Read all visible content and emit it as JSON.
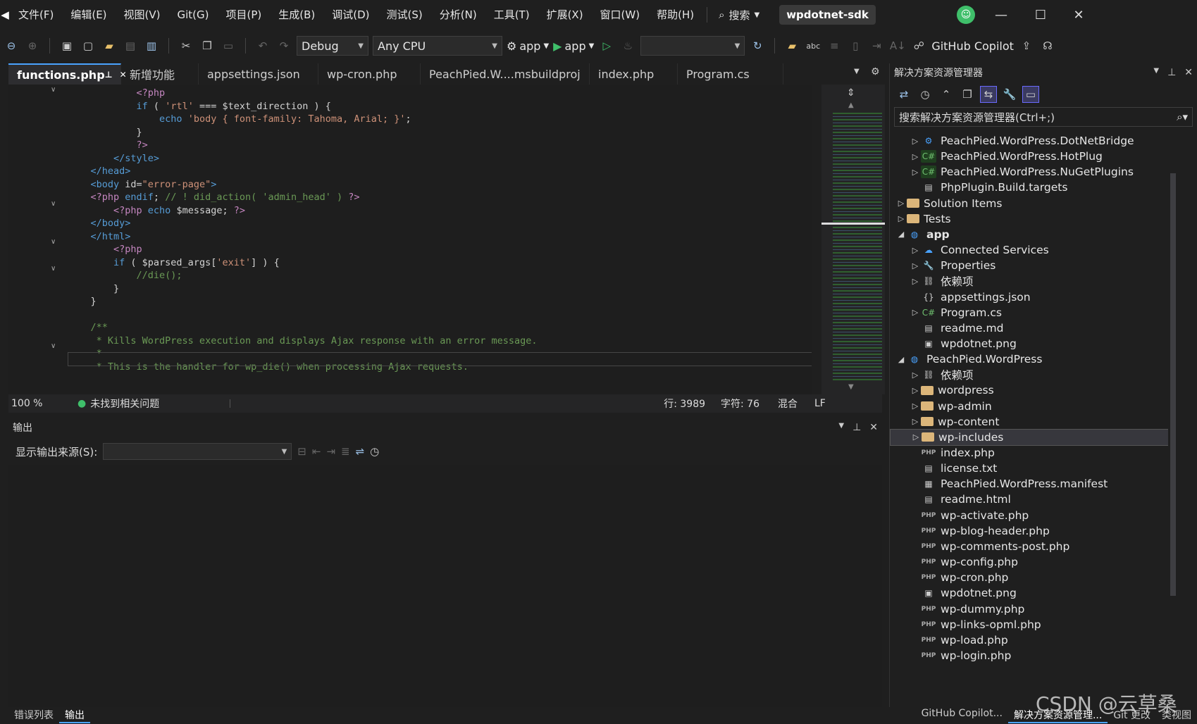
{
  "menubar": {
    "items": [
      "文件(F)",
      "编辑(E)",
      "视图(V)",
      "Git(G)",
      "项目(P)",
      "生成(B)",
      "调试(D)",
      "测试(S)",
      "分析(N)",
      "工具(T)",
      "扩展(X)",
      "窗口(W)",
      "帮助(H)"
    ],
    "search_label": "搜索",
    "solution_title": "wpdotnet-sdk"
  },
  "toolbar": {
    "config": "Debug",
    "platform": "Any CPU",
    "startup1": "app",
    "startup2": "app",
    "copilot": "GitHub Copilot"
  },
  "tabs": [
    "functions.php",
    "新增功能",
    "appsettings.json",
    "wp-cron.php",
    "PeachPied.W....msbuildproj",
    "index.php",
    "Program.cs"
  ],
  "editor": {
    "lines": [
      [
        {
          "c": "ph",
          "t": "            <?php"
        }
      ],
      [
        {
          "c": "kw",
          "t": "            if"
        },
        {
          "c": "tx",
          "t": " ( "
        },
        {
          "c": "st",
          "t": "'rtl'"
        },
        {
          "c": "tx",
          "t": " === $text_direction ) {"
        }
      ],
      [
        {
          "c": "kw",
          "t": "                echo "
        },
        {
          "c": "st",
          "t": "'body { font-family: Tahoma, Arial; }'"
        },
        {
          "c": "tx",
          "t": ";"
        }
      ],
      [
        {
          "c": "tx",
          "t": "            }"
        }
      ],
      [
        {
          "c": "ph",
          "t": "            ?>"
        }
      ],
      [
        {
          "c": "kw",
          "t": "        </style>"
        }
      ],
      [
        {
          "c": "kw",
          "t": "    </head>"
        }
      ],
      [
        {
          "c": "kw",
          "t": "    <body "
        },
        {
          "c": "tx",
          "t": "id="
        },
        {
          "c": "st",
          "t": "\"error-page\""
        },
        {
          "c": "kw",
          "t": ">"
        }
      ],
      [
        {
          "c": "ph",
          "t": "    <?php "
        },
        {
          "c": "kw",
          "t": "endif"
        },
        {
          "c": "tx",
          "t": "; "
        },
        {
          "c": "cm",
          "t": "// ! did_action( 'admin_head' ) "
        },
        {
          "c": "ph",
          "t": "?>"
        }
      ],
      [
        {
          "c": "ph",
          "t": "        <?php "
        },
        {
          "c": "kw",
          "t": "echo "
        },
        {
          "c": "tx",
          "t": "$message; "
        },
        {
          "c": "ph",
          "t": "?>"
        }
      ],
      [
        {
          "c": "kw",
          "t": "    </body>"
        }
      ],
      [
        {
          "c": "kw",
          "t": "    </html>"
        }
      ],
      [
        {
          "c": "ph",
          "t": "        <?php"
        }
      ],
      [
        {
          "c": "kw",
          "t": "        if"
        },
        {
          "c": "tx",
          "t": " ( $parsed_args["
        },
        {
          "c": "st",
          "t": "'exit'"
        },
        {
          "c": "tx",
          "t": "] ) {"
        }
      ],
      [
        {
          "c": "cm",
          "t": "            //die();"
        }
      ],
      [
        {
          "c": "tx",
          "t": "        }"
        }
      ],
      [
        {
          "c": "tx",
          "t": "    }"
        }
      ],
      [
        {
          "c": "tx",
          "t": ""
        }
      ],
      [
        {
          "c": "cm",
          "t": "    /**"
        }
      ],
      [
        {
          "c": "cm",
          "t": "     * Kills WordPress execution and displays Ajax response with an error message."
        }
      ],
      [
        {
          "c": "cm",
          "t": "     *"
        }
      ],
      [
        {
          "c": "cm",
          "t": "     * This is the handler for wp_die() when processing Ajax requests."
        }
      ]
    ]
  },
  "status": {
    "zoom": "100 %",
    "issues": "未找到相关问题",
    "line": "行: 3989",
    "char": "字符: 76",
    "mixed": "混合",
    "eol": "LF"
  },
  "output": {
    "title": "输出",
    "source_label": "显示输出来源(S):"
  },
  "solution": {
    "title": "解决方案资源管理器",
    "search_placeholder": "搜索解决方案资源管理器(Ctrl+;)",
    "items": [
      {
        "label": "PeachPied.WordPress.DotNetBridge",
        "indent": 2,
        "exp": "▷",
        "icon": "project-icon"
      },
      {
        "label": "PeachPied.WordPress.HotPlug",
        "indent": 2,
        "exp": "▷",
        "icon": "csharp-project-icon"
      },
      {
        "label": "PeachPied.WordPress.NuGetPlugins",
        "indent": 2,
        "exp": "▷",
        "icon": "csharp-project-icon"
      },
      {
        "label": "PhpPlugin.Build.targets",
        "indent": 2,
        "exp": "",
        "icon": "file-icon"
      },
      {
        "label": "Solution Items",
        "indent": 1,
        "exp": "▷",
        "icon": "folder-icon"
      },
      {
        "label": "Tests",
        "indent": 1,
        "exp": "▷",
        "icon": "folder-icon"
      },
      {
        "label": "app",
        "indent": 1,
        "exp": "◢",
        "icon": "web-project-icon",
        "bold": true
      },
      {
        "label": "Connected Services",
        "indent": 2,
        "exp": "▷",
        "icon": "connected-services-icon"
      },
      {
        "label": "Properties",
        "indent": 2,
        "exp": "▷",
        "icon": "properties-icon"
      },
      {
        "label": "依赖项",
        "indent": 2,
        "exp": "▷",
        "icon": "dependencies-icon"
      },
      {
        "label": "appsettings.json",
        "indent": 2,
        "exp": "",
        "icon": "json-file-icon"
      },
      {
        "label": "Program.cs",
        "indent": 2,
        "exp": "▷",
        "icon": "csharp-file-icon"
      },
      {
        "label": "readme.md",
        "indent": 2,
        "exp": "",
        "icon": "markdown-file-icon"
      },
      {
        "label": "wpdotnet.png",
        "indent": 2,
        "exp": "",
        "icon": "image-file-icon"
      },
      {
        "label": "PeachPied.WordPress",
        "indent": 1,
        "exp": "◢",
        "icon": "web-project-icon"
      },
      {
        "label": "依赖项",
        "indent": 2,
        "exp": "▷",
        "icon": "dependencies-icon"
      },
      {
        "label": "wordpress",
        "indent": 2,
        "exp": "▷",
        "icon": "folder-icon"
      },
      {
        "label": "wp-admin",
        "indent": 2,
        "exp": "▷",
        "icon": "folder-icon"
      },
      {
        "label": "wp-content",
        "indent": 2,
        "exp": "▷",
        "icon": "folder-icon"
      },
      {
        "label": "wp-includes",
        "indent": 2,
        "exp": "▷",
        "icon": "folder-icon",
        "selected": true
      },
      {
        "label": "index.php",
        "indent": 2,
        "exp": "",
        "icon": "php-file-icon"
      },
      {
        "label": "license.txt",
        "indent": 2,
        "exp": "",
        "icon": "text-file-icon"
      },
      {
        "label": "PeachPied.WordPress.manifest",
        "indent": 2,
        "exp": "",
        "icon": "manifest-file-icon"
      },
      {
        "label": "readme.html",
        "indent": 2,
        "exp": "",
        "icon": "html-file-icon"
      },
      {
        "label": "wp-activate.php",
        "indent": 2,
        "exp": "",
        "icon": "php-file-icon"
      },
      {
        "label": "wp-blog-header.php",
        "indent": 2,
        "exp": "",
        "icon": "php-file-icon"
      },
      {
        "label": "wp-comments-post.php",
        "indent": 2,
        "exp": "",
        "icon": "php-file-icon"
      },
      {
        "label": "wp-config.php",
        "indent": 2,
        "exp": "",
        "icon": "php-file-icon"
      },
      {
        "label": "wp-cron.php",
        "indent": 2,
        "exp": "",
        "icon": "php-file-icon"
      },
      {
        "label": "wpdotnet.png",
        "indent": 2,
        "exp": "",
        "icon": "image-file-icon"
      },
      {
        "label": "wp-dummy.php",
        "indent": 2,
        "exp": "",
        "icon": "php-file-icon"
      },
      {
        "label": "wp-links-opml.php",
        "indent": 2,
        "exp": "",
        "icon": "php-file-icon"
      },
      {
        "label": "wp-load.php",
        "indent": 2,
        "exp": "",
        "icon": "php-file-icon"
      },
      {
        "label": "wp-login.php",
        "indent": 2,
        "exp": "",
        "icon": "php-file-icon"
      }
    ]
  },
  "bottom_tabs": {
    "left": [
      "错误列表",
      "输出"
    ],
    "right": [
      "GitHub Copilot...",
      "解决方案资源管理...",
      "Git 更改",
      "类视图"
    ]
  },
  "watermark": "CSDN @云草桑",
  "colors": {
    "accent": "#4aa3ff",
    "background": "#1f1f1f",
    "editor": "#1e1e1e"
  }
}
